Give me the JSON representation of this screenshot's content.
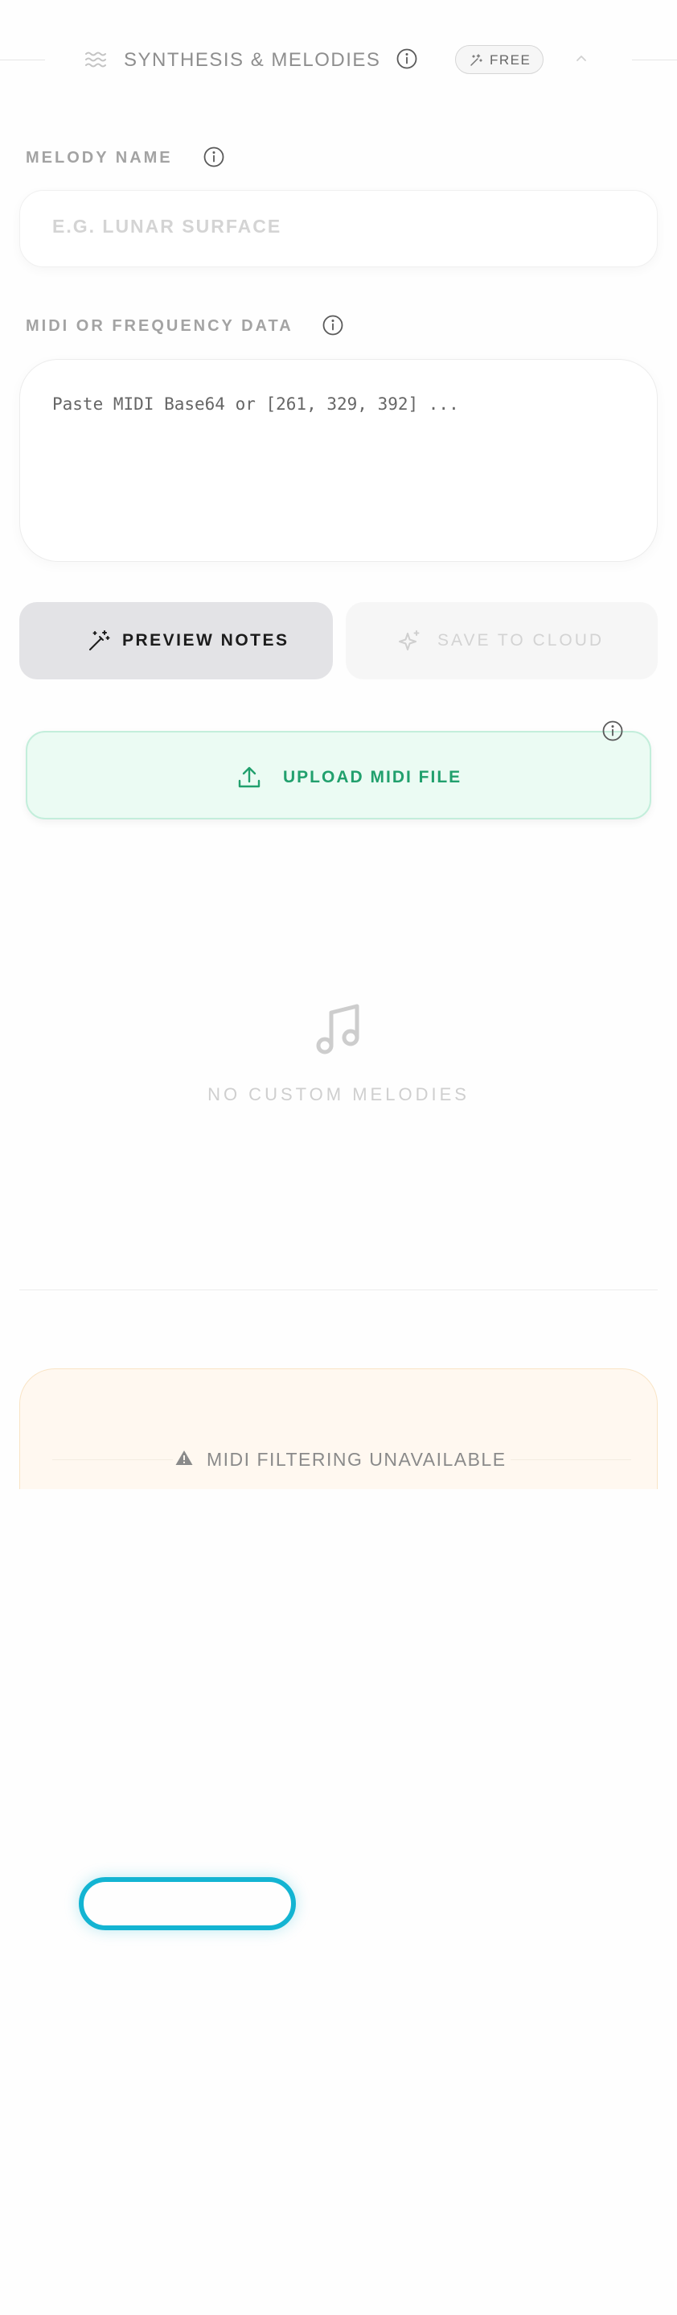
{
  "header": {
    "title": "SYNTHESIS & MELODIES",
    "badge": "FREE"
  },
  "melody_name": {
    "label": "MELODY NAME",
    "placeholder": "E.G. LUNAR SURFACE",
    "value": ""
  },
  "midi_data": {
    "label": "MIDI OR FREQUENCY DATA",
    "placeholder": "Paste MIDI Base64 or [261, 329, 392] ...",
    "value": ""
  },
  "actions": {
    "preview_label": "PREVIEW NOTES",
    "save_label": "SAVE TO CLOUD"
  },
  "upload": {
    "label": "UPLOAD MIDI FILE"
  },
  "empty_state": {
    "text": "NO CUSTOM MELODIES"
  },
  "warning": {
    "text": "MIDI FILTERING UNAVAILABLE"
  },
  "colors": {
    "accent_green": "#21a06d",
    "upload_bg": "#ebfbf3",
    "warning_bg": "#fff8f0",
    "focus_ring": "#13b4d2"
  },
  "icons": {
    "header": "waves-icon",
    "badge": "sparkle-icon",
    "collapse": "chevron-up-icon",
    "info": "info-icon",
    "preview": "magic-wand-icon",
    "save": "sparkles-icon",
    "upload": "upload-icon",
    "empty": "music-note-icon",
    "warning": "warning-triangle-icon"
  }
}
